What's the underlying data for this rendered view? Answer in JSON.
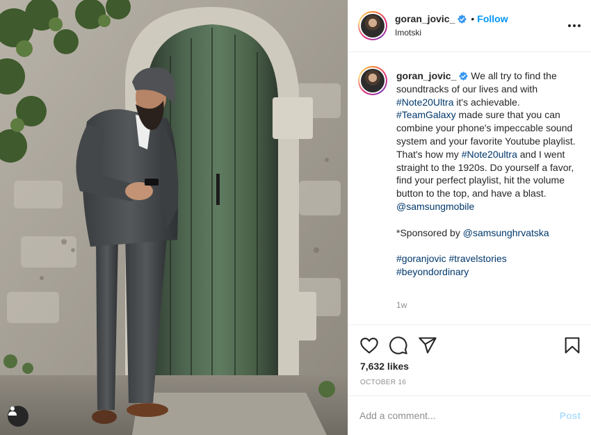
{
  "post": {
    "username": "goran_jovic_",
    "follow_label": "Follow",
    "separator": "•",
    "location": "Imotski"
  },
  "caption": {
    "username": "goran_jovic_",
    "seg1": " We all try to find the soundtracks of our lives and with ",
    "tag1": "#Note20Ultra",
    "seg2": " it's achievable. ",
    "tag2": "#TeamGalaxy",
    "seg3": " made sure that you can combine your phone's impeccable sound system and your favorite Youtube playlist. That's how my ",
    "tag3": "#Note20ultra",
    "seg4": " and I went straight to the 1920s. Do yourself a favor, find your perfect playlist, hit the volume button to the top, and have a blast. ",
    "mention1": "@samsungmobile",
    "sponsored_prefix": "*Sponsored by ",
    "mention2": "@samsunghrvatska",
    "hashtag1": "#goranjovic",
    "hashtag2": "#travelstories",
    "hashtag3": "#beyondordinary",
    "time_ago": "1w"
  },
  "actions": {
    "likes": "7,632 likes",
    "date": "OCTOBER 16",
    "icons": [
      "heart-icon",
      "comment-icon",
      "share-icon",
      "bookmark-icon"
    ]
  },
  "comment": {
    "placeholder": "Add a comment...",
    "post_label": "Post"
  },
  "colors": {
    "accent": "#0095f6",
    "hashtag": "#00376b",
    "post_disabled": "#b2dffc",
    "muted": "#8e8e8e"
  }
}
